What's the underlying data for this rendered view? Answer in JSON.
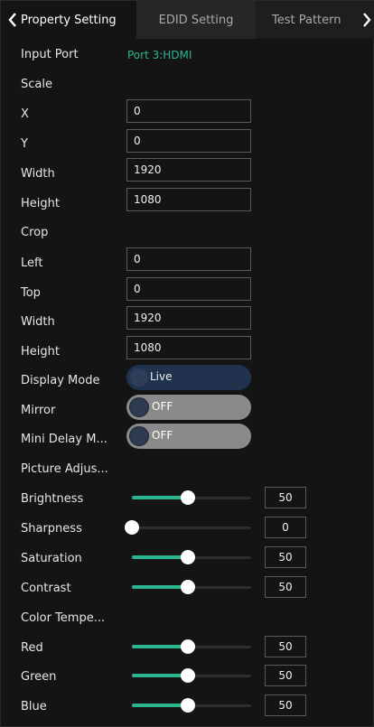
{
  "tabs": {
    "active": "Property Setting",
    "second": "EDID Setting",
    "third": "Test Pattern"
  },
  "input_port": {
    "label": "Input Port",
    "value": "Port 3:HDMI"
  },
  "scale": {
    "heading": "Scale",
    "x": {
      "label": "X",
      "value": "0"
    },
    "y": {
      "label": "Y",
      "value": "0"
    },
    "width": {
      "label": "Width",
      "value": "1920"
    },
    "height": {
      "label": "Height",
      "value": "1080"
    }
  },
  "crop": {
    "heading": "Crop",
    "left": {
      "label": "Left",
      "value": "0"
    },
    "top": {
      "label": "Top",
      "value": "0"
    },
    "width": {
      "label": "Width",
      "value": "1920"
    },
    "height": {
      "label": "Height",
      "value": "1080"
    }
  },
  "display_mode": {
    "label": "Display Mode",
    "value": "Live"
  },
  "mirror": {
    "label": "Mirror",
    "value": "OFF"
  },
  "mini_delay": {
    "label": "Mini Delay M...",
    "value": "OFF"
  },
  "picture_adjust": {
    "heading": "Picture Adjus...",
    "brightness": {
      "label": "Brightness",
      "value": "50",
      "level": 0.5
    },
    "sharpness": {
      "label": "Sharpness",
      "value": "0",
      "level": 0
    },
    "saturation": {
      "label": "Saturation",
      "value": "50",
      "level": 0.5
    },
    "contrast": {
      "label": "Contrast",
      "value": "50",
      "level": 0.5
    }
  },
  "color_temp": {
    "heading": "Color Tempe...",
    "red": {
      "label": "Red",
      "value": "50",
      "level": 0.5
    },
    "green": {
      "label": "Green",
      "value": "50",
      "level": 0.5
    },
    "blue": {
      "label": "Blue",
      "value": "50",
      "level": 0.5
    }
  },
  "colors": {
    "accent": "#2bb58f",
    "background": "#141414"
  }
}
